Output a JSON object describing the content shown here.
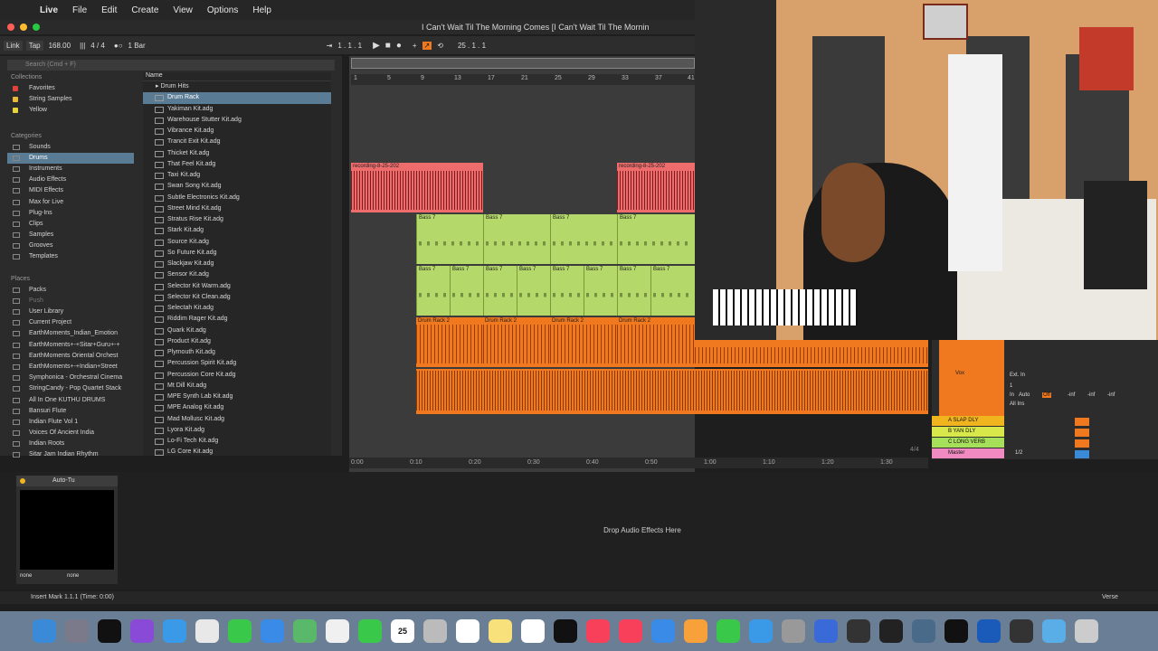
{
  "menubar": {
    "apple": "",
    "app_name": "Live",
    "items": [
      "File",
      "Edit",
      "Create",
      "View",
      "Options",
      "Help"
    ]
  },
  "window": {
    "title": "I Can't Wait Til The Morning Comes  [I Can't Wait Til The Mornin"
  },
  "transport": {
    "link": "Link",
    "tap": "Tap",
    "tempo": "168.00",
    "time_signature": "4 / 4",
    "quantize": "1 Bar",
    "position": "1 .  1 .  1",
    "loop_start": "25 .  1 .  1"
  },
  "browser": {
    "search_placeholder": "Search (Cmd + F)",
    "collections_header": "Collections",
    "collections": [
      {
        "label": "Favorites",
        "color": "#e0413a"
      },
      {
        "label": "String Samples",
        "color": "#e8b93a"
      },
      {
        "label": "Yellow",
        "color": "#e8d43a"
      }
    ],
    "categories_header": "Categories",
    "categories": [
      "Sounds",
      "Drums",
      "Instruments",
      "Audio Effects",
      "MIDI Effects",
      "Max for Live",
      "Plug-Ins",
      "Clips",
      "Samples",
      "Grooves",
      "Templates"
    ],
    "selected_category": "Drums",
    "places_header": "Places",
    "places": [
      "Packs",
      "Push",
      "User Library",
      "Current Project",
      "EarthMoments_Indian_Emotion",
      "EarthMoments+-+Sitar+Guru+-+",
      "EarthMoments Oriental Orchest",
      "EarthMoments+-+Indian+Street",
      "Symphonica - Orchestral Cinema",
      "StringCandy - Pop Quartet Stack",
      "All In One KUTHU DRUMS",
      "Bansuri Flute",
      "Indian Flute Vol 1",
      "Voices Of Ancient India",
      "Indian Roots",
      "Sitar Jam Indian Rhythm"
    ],
    "content_header": "Name",
    "folder": "Drum Hits",
    "files": [
      "Drum Rack",
      "Yakiman Kit.adg",
      "Warehouse Stutter Kit.adg",
      "Vibrance Kit.adg",
      "Trancit Exit Kit.adg",
      "Thicket Kit.adg",
      "That Feel Kit.adg",
      "Taxi Kit.adg",
      "Swan Song Kit.adg",
      "Subtle Electronics Kit.adg",
      "Street Mind Kit.adg",
      "Stratus Rise Kit.adg",
      "Stark Kit.adg",
      "Source Kit.adg",
      "So Future Kit.adg",
      "Slackjaw Kit.adg",
      "Sensor Kit.adg",
      "Selector Kit Warm.adg",
      "Selector Kit Clean.adg",
      "Selectah Kit.adg",
      "Riddim Rager Kit.adg",
      "Quark Kit.adg",
      "Product Kit.adg",
      "Plymouth Kit.adg",
      "Percussion Spirit Kit.adg",
      "Percussion Core Kit.adg",
      "Mt Dill Kit.adg",
      "MPE Synth Lab Kit.adg",
      "MPE Analog Kit.adg",
      "Mad Mollusc Kit.adg",
      "Lyora Kit.adg",
      "Lo-Fi Tech Kit.adg",
      "LG Core Kit.adg"
    ],
    "selected_file": "Drum Rack"
  },
  "arrangement": {
    "ruler": [
      "1",
      "5",
      "9",
      "13",
      "17",
      "21",
      "25",
      "29",
      "33",
      "37",
      "41"
    ],
    "time_labels": [
      "0:00",
      "0:10",
      "0:20",
      "0:30",
      "0:40",
      "0:50",
      "1:00",
      "1:10",
      "1:20",
      "1:30"
    ],
    "clips": {
      "recording": "recording-8-25-202",
      "bass": "Bass 7",
      "drum": "Drum Rack 2"
    },
    "page_indicator": "4/4"
  },
  "mixer": {
    "tracks": [
      {
        "label": "A SLAP DLY",
        "color": "#f0b41e"
      },
      {
        "label": "B YAN DLY",
        "color": "#d8e84a"
      },
      {
        "label": "C LONG VERB",
        "color": "#a6e05a"
      },
      {
        "label": "Master",
        "color": "#f08ac0"
      }
    ],
    "vox_label": "Vox",
    "ext_in": "Ext. In",
    "all_ins": "All Ins",
    "in": "In",
    "auto": "Auto",
    "off": "Off",
    "channel": "1",
    "ratio": "1/2",
    "inf": "-inf"
  },
  "device": {
    "title": "Auto-Tu",
    "none1": "none",
    "none2": "none",
    "drop_text": "Drop Audio Effects Here"
  },
  "status": {
    "message": "Insert Mark 1.1.1 (Time: 0:00)",
    "verse": "Verse"
  },
  "dock": {
    "calendar_day": "25",
    "icons": [
      "finder-icon",
      "launchpad-icon",
      "ableton-live-icon",
      "siri-icon",
      "safari-icon",
      "chrome-icon",
      "messages-icon",
      "mail-icon",
      "maps-icon",
      "photos-icon",
      "facetime-icon",
      "calendar-icon",
      "contacts-icon",
      "reminders-icon",
      "notes-icon",
      "freeform-icon",
      "apple-tv-icon",
      "music-icon",
      "news-icon",
      "keynote-icon",
      "pages-icon",
      "numbers-icon",
      "app-store-icon",
      "system-settings-icon",
      "preview-icon",
      "chatgpt-icon",
      "finalcut-icon",
      "davinci-icon",
      "capcut-icon",
      "obs-icon",
      "screen-icon",
      "folder-icon",
      "trash-icon"
    ]
  }
}
